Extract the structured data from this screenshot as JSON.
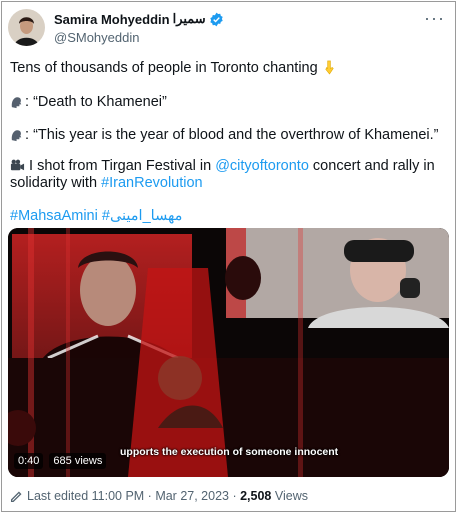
{
  "author": {
    "display_name": "Samira Mohyeddin",
    "display_name_fa": "سمیرا",
    "handle": "@SMohyeddin"
  },
  "more_label": "···",
  "tweet": {
    "line1": "Tens of thousands of people in Toronto chanting",
    "line2_prefix": ": ",
    "line2_quote": "“Death to Khamenei”",
    "line3_prefix": ": ",
    "line3_quote": "“This year is the year of blood and the overthrow of Khamenei.”",
    "line4_text": " I shot from Tirgan Festival in ",
    "line4_link": "@cityoftoronto",
    "line4_suffix": " concert and rally in",
    "line5_text": "solidarity with ",
    "line5_link": "#IranRevolution",
    "line6_tag1": "#MahsaAmini",
    "line6_tag2": "#مهسا_امینی"
  },
  "media": {
    "duration": "0:40",
    "views": "685 views",
    "caption": "upports the execution of someone innocent"
  },
  "footer": {
    "edited_label": "Last edited 11:00 PM · Mar 27, 2023 · ",
    "view_count": "2,508",
    "views_label": " Views"
  }
}
